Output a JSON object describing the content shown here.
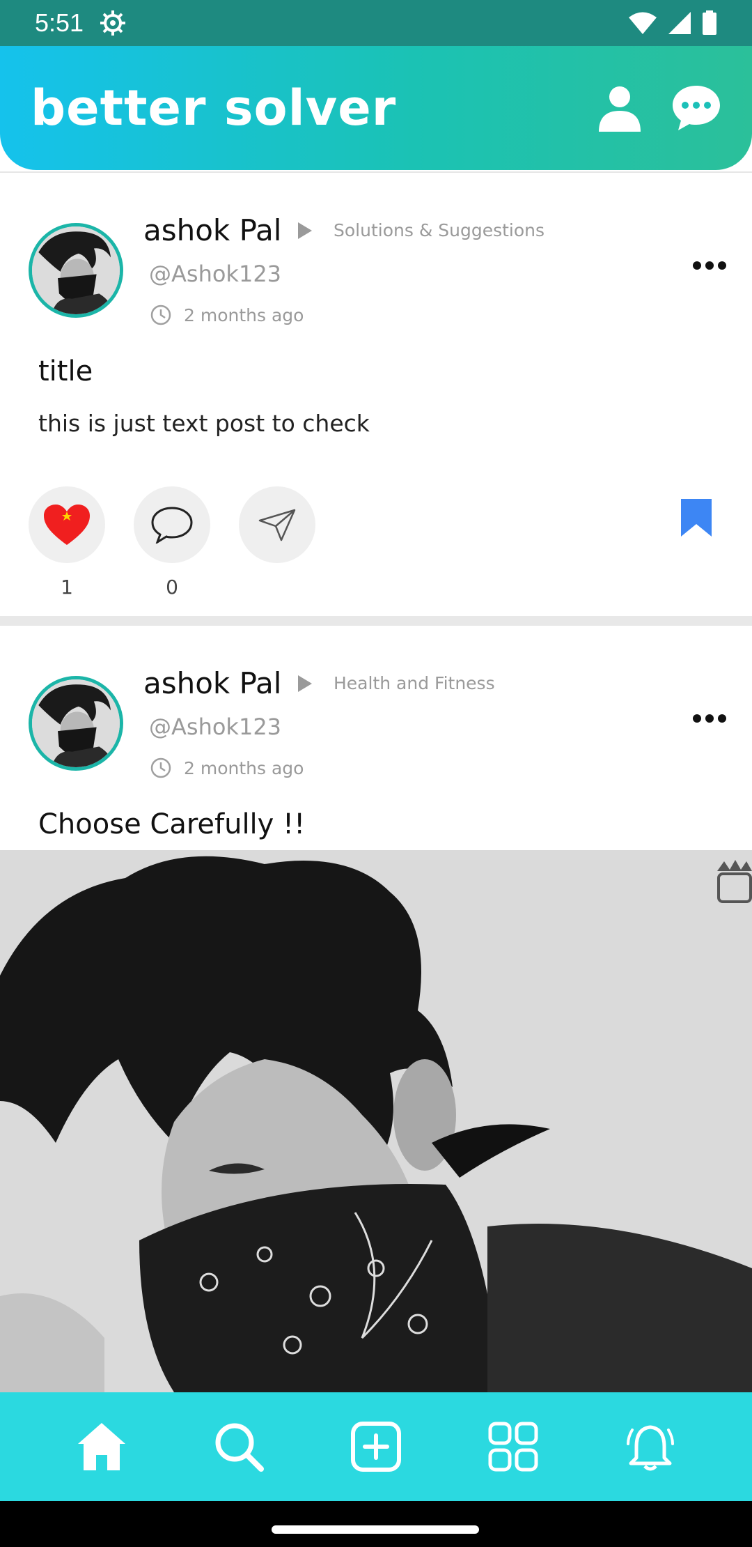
{
  "status_bar": {
    "time": "5:51",
    "icons": [
      "settings-gear-icon",
      "wifi-icon",
      "signal-icon",
      "battery-icon"
    ]
  },
  "header": {
    "title": "better solver",
    "icons": [
      "profile-icon",
      "chat-icon"
    ],
    "gradient_colors": [
      "#15c2ec",
      "#2bc09a"
    ]
  },
  "posts": [
    {
      "user_name": "ashok Pal",
      "category": "Solutions & Suggestions",
      "handle": "@Ashok123",
      "time_ago": "2 months ago",
      "title": "title",
      "text": "this is just text post to check",
      "likes": "1",
      "comments": "0",
      "liked": true,
      "bookmarked": true
    },
    {
      "user_name": "ashok Pal",
      "category": "Health and Fitness",
      "handle": "@Ashok123",
      "time_ago": "2 months ago",
      "title": "Choose Carefully !!",
      "has_image": true
    }
  ],
  "bottom_nav": {
    "items": [
      "home-icon",
      "search-icon",
      "add-post-icon",
      "categories-icon",
      "notifications-icon"
    ],
    "active": "home-icon",
    "background": "#2bd9e0"
  },
  "colors": {
    "accent": "#1bb5a8",
    "like": "#f01f1f",
    "bookmark": "#3d86f4"
  }
}
